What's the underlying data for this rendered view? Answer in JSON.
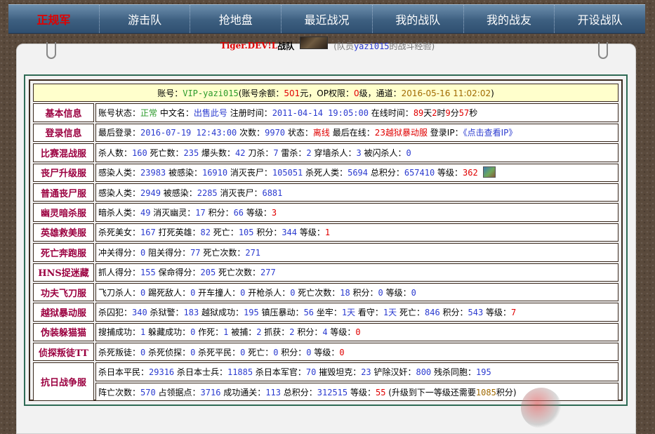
{
  "nav": {
    "items": [
      "正规军",
      "游击队",
      "抢地盘",
      "最近战况",
      "我的战队",
      "我的战友",
      "开设战队"
    ],
    "active_index": 0
  },
  "title": {
    "team_name": "Tiger.DEV!L",
    "team_suffix": "战队",
    "subtitle_prefix": "(队员",
    "member": "yazi015",
    "subtitle_suffix": "的战斗经验)"
  },
  "header": {
    "account_label": "账号：",
    "account": "VIP-yazi015",
    "balance_label": "(账号余额：",
    "balance": "501",
    "balance_unit": "元，OP权限：",
    "op_level": "0",
    "level_unit": "级，通道：",
    "channel_time": "2016-05-16 11:02:02",
    "close": ")"
  },
  "rows": {
    "basic": {
      "cat": "基本信息",
      "t1": "账号状态：",
      "status": "正常",
      "t2": " 中文名：",
      "cn_name": "出售此号",
      "t3": " 注册时间：",
      "reg_time": "2011-04-14 19:05:00",
      "t4": " 在线时间：",
      "days": "89",
      "t5": "天",
      "hours": "2",
      "t6": "时",
      "mins": "9",
      "t7": "分",
      "secs": "57",
      "t8": "秒"
    },
    "login": {
      "cat": "登录信息",
      "t1": "最后登录：",
      "last_login": "2016-07-19 12:43:00",
      "t2": " 次数：",
      "count": "9970",
      "t3": " 状态：",
      "state": "离线",
      "t4": " 最后在线：",
      "last_online": "23越狱暴动服",
      "t5": " 登录IP：",
      "ip_link": "《点击查看IP》"
    },
    "mix": {
      "cat": "比赛混战服",
      "t1": "杀人数：",
      "kills": "160",
      "t2": " 死亡数：",
      "deaths": "235",
      "t3": " 爆头数：",
      "headshots": "42",
      "t4": " 刀杀：",
      "knife": "7",
      "t5": " 雷杀：",
      "grenade": "2",
      "t6": " 穿墙杀人：",
      "wall": "3",
      "t7": " 被闪杀人：",
      "flash": "0"
    },
    "zombie_up": {
      "cat": "丧尸升级服",
      "t1": "感染人类：",
      "infect": "23983",
      "t2": " 被感染：",
      "infected": "16910",
      "t3": " 消灭丧尸：",
      "kill_z": "105051",
      "t4": " 杀死人类：",
      "kill_h": "5694",
      "t5": " 总积分：",
      "score": "657410",
      "t6": " 等级：",
      "level": "362"
    },
    "zombie": {
      "cat": "普通丧尸服",
      "t1": "感染人类：",
      "infect": "2949",
      "t2": " 被感染：",
      "infected": "2285",
      "t3": " 消灭丧尸：",
      "kill_z": "6881"
    },
    "ghost": {
      "cat": "幽灵暗杀服",
      "t1": "暗杀人类：",
      "assassinate": "49",
      "t2": " 消灭幽灵：",
      "kill_ghost": "17",
      "t3": " 积分：",
      "score": "66",
      "t4": " 等级：",
      "level": "3"
    },
    "hero": {
      "cat": "英雄救美服",
      "t1": "杀死美女：",
      "kill_beauty": "167",
      "t2": " 打死英雄：",
      "kill_hero": "82",
      "t3": " 死亡：",
      "deaths": "105",
      "t4": " 积分：",
      "score": "344",
      "t5": " 等级：",
      "level": "1"
    },
    "death_run": {
      "cat": "死亡奔跑服",
      "t1": "冲关得分：",
      "rush": "0",
      "t2": " 阻关得分：",
      "block": "77",
      "t3": " 死亡次数：",
      "deaths": "271"
    },
    "hns": {
      "cat": "HNS捉迷藏",
      "t1": "抓人得分：",
      "catch": "155",
      "t2": " 保命得分：",
      "survive": "205",
      "t3": " 死亡次数：",
      "deaths": "277"
    },
    "kungfu": {
      "cat": "功夫飞刀服",
      "t1": "飞刀杀人：",
      "knife_kill": "0",
      "t2": " 踢死敌人：",
      "kick": "0",
      "t3": " 开车撞人：",
      "car": "0",
      "t4": " 开枪杀人：",
      "gun": "0",
      "t5": " 死亡次数：",
      "deaths": "18",
      "t6": " 积分：",
      "score": "0",
      "t7": " 等级：",
      "level": "0"
    },
    "jail": {
      "cat": "越狱暴动服",
      "t1": "杀囚犯：",
      "kill_prisoner": "340",
      "t2": " 杀狱警：",
      "kill_guard": "183",
      "t3": " 越狱成功：",
      "escape": "195",
      "t4": " 镇压暴动：",
      "suppress": "56",
      "t5": " 坐牢：",
      "jail_days": "1",
      "t6": "天",
      "t7": " 看守：",
      "guard_days": "1",
      "t8": "天",
      "t9": " 死亡：",
      "deaths": "846",
      "t10": " 积分：",
      "score": "543",
      "t11": " 等级：",
      "level": "7"
    },
    "hide": {
      "cat": "伪装躲猫猫",
      "t1": "搜捕成功：",
      "search": "1",
      "t2": " 躲藏成功：",
      "hide_ok": "0",
      "t3": " 作死：",
      "suicide": "1",
      "t4": " 被捕：",
      "caught": "2",
      "t5": " 抓获：",
      "captured": "2",
      "t6": " 积分：",
      "score": "4",
      "t7": " 等级：",
      "level": "0"
    },
    "detect": {
      "cat": "侦探叛徒TT",
      "t1": "杀死叛徒：",
      "kill_traitor": "0",
      "t2": " 杀死侦探：",
      "kill_detective": "0",
      "t3": " 杀死平民：",
      "kill_civil": "0",
      "t4": " 死亡：",
      "deaths": "0",
      "t5": " 积分：",
      "score": "0",
      "t6": " 等级：",
      "level": "0"
    },
    "anti_jp": {
      "cat": "抗日战争服",
      "l1": {
        "t1": "杀日本平民：",
        "civil": "29316",
        "t2": " 杀日本士兵：",
        "soldier": "11885",
        "t3": " 杀日本军官：",
        "officer": "70",
        "t4": " 摧毁坦克：",
        "tank": "23",
        "t5": " 铲除汉奸：",
        "traitor": "800",
        "t6": " 残杀同胞：",
        "compat": "195"
      },
      "l2": {
        "t1": "阵亡次数：",
        "deaths": "570",
        "t2": " 占领据点：",
        "occupy": "3716",
        "t3": " 成功通关：",
        "clear": "113",
        "t4": " 总积分：",
        "score": "312515",
        "t5": " 等级：",
        "level": "55",
        "t6": " (升级到下一等级还需要",
        "need": "1085",
        "t7": "积分)"
      }
    }
  },
  "colors": {
    "nav_bg": "#3d5f80",
    "active_nav": "#e00000",
    "value_blue": "#2b3bd0",
    "value_red": "#e00000",
    "status_green": "#2a9a2a",
    "category_text": "#9b0040",
    "header_bg": "#ffffcc"
  },
  "icons": {
    "avatar": "team-avatar-image",
    "level_badge": "level-picture-icon",
    "watermark": "site-logo-watermark"
  }
}
